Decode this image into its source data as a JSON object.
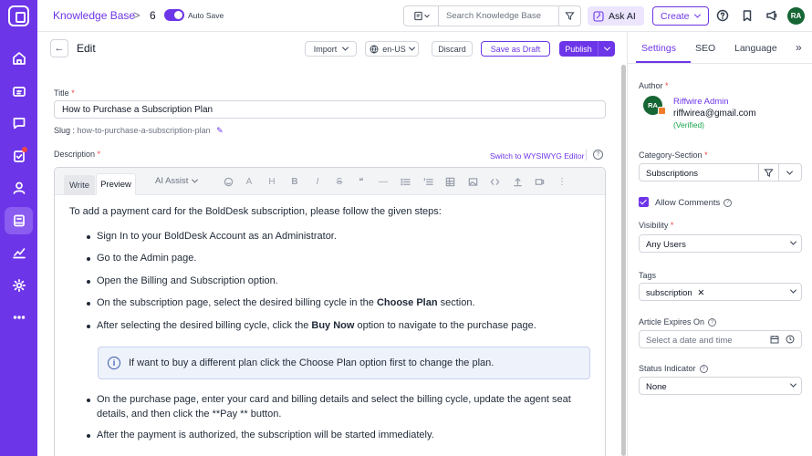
{
  "topbar": {
    "breadcrumb": "Knowledge Base",
    "separator": ">",
    "article_number": "6",
    "autosave_label": "Auto Save",
    "search_placeholder": "Search Knowledge Base",
    "ask_ai_label": "Ask AI",
    "create_label": "Create",
    "user_initials": "RA"
  },
  "editor_header": {
    "back_icon": "arrow-left-icon",
    "title": "Edit",
    "import_label": "Import",
    "locale_label": "en-US",
    "discard_label": "Discard",
    "save_draft_label": "Save as Draft",
    "publish_label": "Publish"
  },
  "form": {
    "title_label": "Title",
    "title_value": "How to Purchase a Subscription Plan",
    "slug_label": "Slug :",
    "slug_value": "how-to-purchase-a-subscription-plan",
    "description_label": "Description",
    "wysiwyg_link": "Switch to WYSIWYG Editor",
    "tab_write": "Write",
    "tab_preview": "Preview",
    "ai_assist_label": "AI Assist"
  },
  "content": {
    "intro": "To add a payment card for the BoldDesk subscription, please follow the given steps:",
    "steps": [
      {
        "text": "Sign In to your BoldDesk Account as an Administrator."
      },
      {
        "text": "Go to the Admin page."
      },
      {
        "text": "Open the Billing and Subscription option."
      },
      {
        "pre": "On the subscription page, select the desired billing cycle in the ",
        "bold": "Choose Plan",
        "post": " section."
      },
      {
        "pre": "After selecting the desired billing cycle, click the ",
        "bold": "Buy Now",
        "post": " option to navigate to the purchase page."
      }
    ],
    "note": "If want to buy a different plan click the Choose Plan option first to change the plan.",
    "steps2": [
      "On the purchase page, enter your card and billing details and select the billing cycle, update the agent seat details, and then click the **Pay ** button.",
      "After the payment is authorized, the subscription will be started immediately."
    ]
  },
  "right_panel": {
    "tabs": [
      "Settings",
      "SEO",
      "Language"
    ],
    "author_label": "Author",
    "author_initials": "RA",
    "author_name": "Riffwire Admin",
    "author_email": "riffwirea@gmail.com",
    "author_status": "(Verified)",
    "category_label": "Category-Section",
    "category_value": "Subscriptions",
    "allow_comments_label": "Allow Comments",
    "visibility_label": "Visibility",
    "visibility_value": "Any Users",
    "tags_label": "Tags",
    "tag_value": "subscription",
    "expires_label": "Article Expires On",
    "expires_placeholder": "Select a date and time",
    "status_label": "Status Indicator",
    "status_value": "None"
  },
  "colors": {
    "brand": "#6d35e8",
    "verified": "#16a34a",
    "avatar": "#166534"
  }
}
